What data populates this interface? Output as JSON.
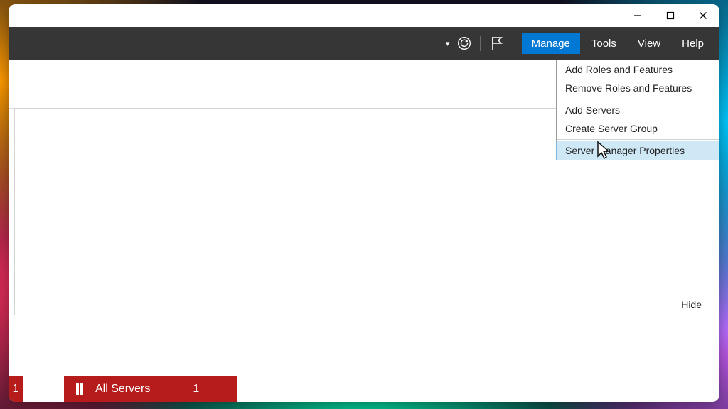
{
  "menus": {
    "manage": "Manage",
    "tools": "Tools",
    "view": "View",
    "help": "Help"
  },
  "dropdown": {
    "add_roles": "Add Roles and Features",
    "remove_roles": "Remove Roles and Features",
    "add_servers": "Add Servers",
    "create_group": "Create Server Group",
    "properties": "Server Manager Properties"
  },
  "content": {
    "hide": "Hide"
  },
  "tiles": {
    "left_count": "1",
    "all_servers_label": "All Servers",
    "all_servers_count": "1"
  }
}
